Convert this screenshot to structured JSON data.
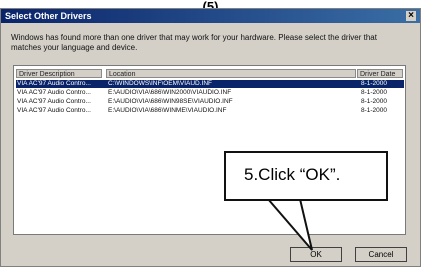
{
  "step_label": "(5)",
  "dialog": {
    "title": "Select Other Drivers",
    "close_glyph": "×",
    "instructions": "Windows has found more than one driver that may work for your hardware. Please select the driver that matches your language and device."
  },
  "table": {
    "columns": [
      "Driver Description",
      "Location",
      "Driver Date"
    ],
    "rows": [
      {
        "desc": "VIA AC'97 Audio Contro...",
        "location": "C:\\WINDOWS\\INF\\OEM\\VIAUD.INF",
        "date": "8-1-2000",
        "selected": true
      },
      {
        "desc": "VIA AC'97 Audio Contro...",
        "location": "E:\\AUDIO\\VIA\\686\\WIN2000\\VIAUDIO.INF",
        "date": "8-1-2000",
        "selected": false
      },
      {
        "desc": "VIA AC'97 Audio Contro...",
        "location": "E:\\AUDIO\\VIA\\686\\WIN98SE\\VIAUDIO.INF",
        "date": "8-1-2000",
        "selected": false
      },
      {
        "desc": "VIA AC'97 Audio Contro...",
        "location": "E:\\AUDIO\\VIA\\686\\WINME\\VIAUDIO.INF",
        "date": "8-1-2000",
        "selected": false
      }
    ]
  },
  "buttons": {
    "ok": "OK",
    "cancel": "Cancel"
  },
  "callout": {
    "text": "5.Click “OK”."
  }
}
